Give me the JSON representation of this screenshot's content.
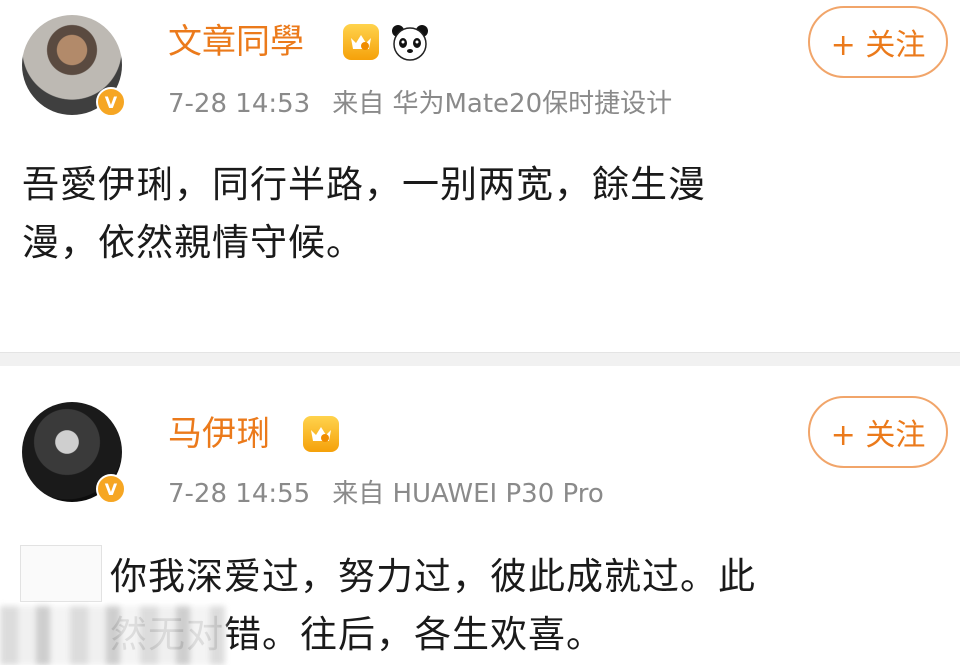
{
  "posts": [
    {
      "username": "文章同學",
      "badge": "V",
      "timestamp": "7-28 14:53",
      "source": "来自 华为Mate20保时捷设计",
      "follow_label": "+ 关注",
      "content_line1": "吾愛伊琍，同行半路，一别两宽，餘生漫",
      "content_line2": "漫，依然親情守候。"
    },
    {
      "username": "马伊琍",
      "badge": "V",
      "timestamp": "7-28 14:55",
      "source": "来自 HUAWEI P30 Pro",
      "follow_label": "+ 关注",
      "content_line1": "你我深爱过，努力过，彼此成就过。此",
      "content_line2": "然无对错。往后，各生欢喜。"
    }
  ],
  "colors": {
    "accent": "#eb7a1b",
    "follow_border": "#f1a56a",
    "meta_text": "#8a8a8a",
    "body_text": "#1a1a1a",
    "verified_badge": "#f6a623"
  },
  "icons": [
    "crown-level-icon",
    "panda-icon",
    "verified-badge-icon"
  ]
}
